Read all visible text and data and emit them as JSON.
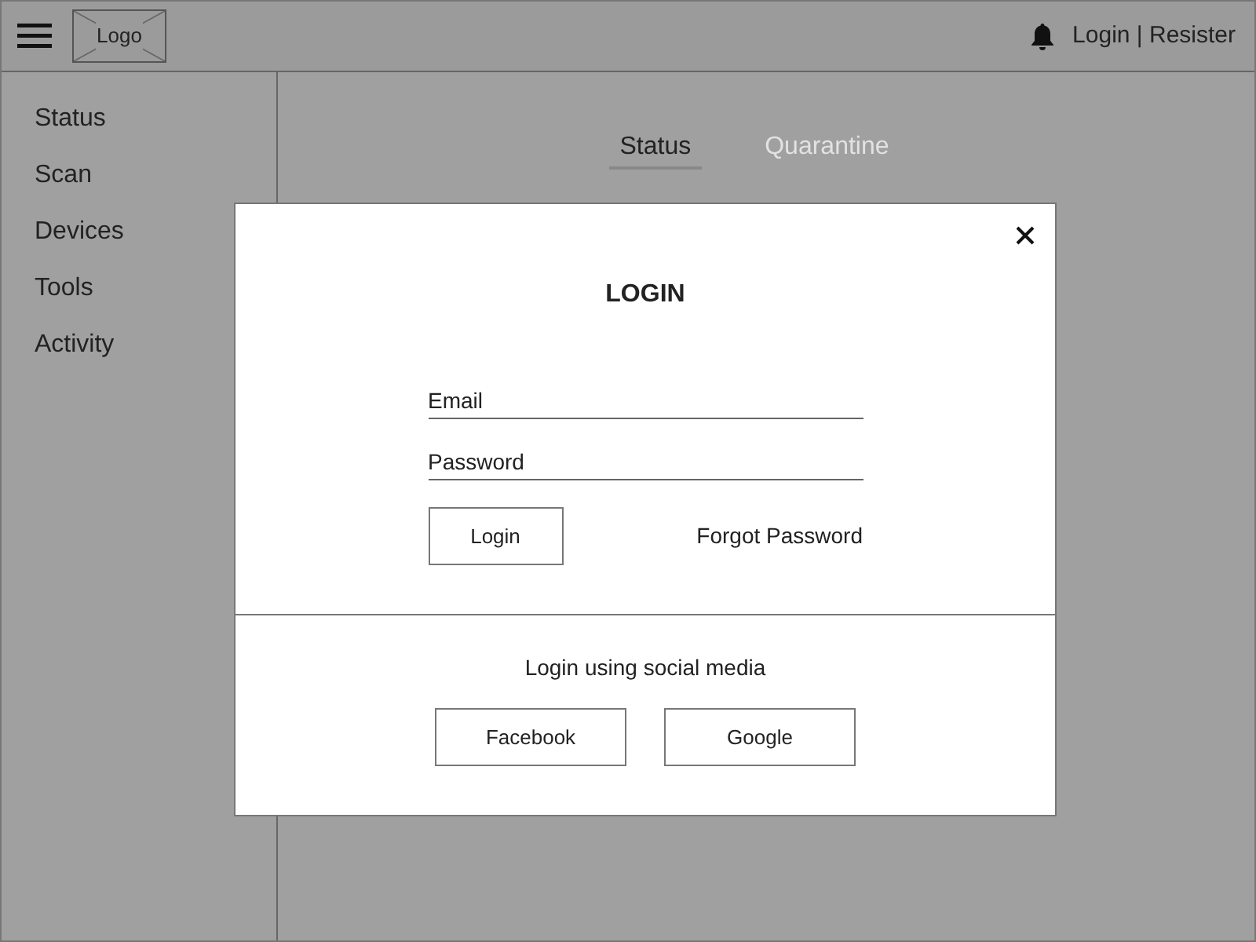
{
  "header": {
    "logo": "Logo",
    "auth_links": "Login | Resister"
  },
  "sidebar": {
    "items": [
      {
        "label": "Status"
      },
      {
        "label": "Scan"
      },
      {
        "label": "Devices"
      },
      {
        "label": "Tools"
      },
      {
        "label": "Activity"
      }
    ]
  },
  "tabs": [
    {
      "label": "Status",
      "selected": true
    },
    {
      "label": "Quarantine",
      "selected": false
    }
  ],
  "dialog": {
    "title": "LOGIN",
    "fields": [
      {
        "placeholder": "Email"
      },
      {
        "placeholder": "Password"
      }
    ],
    "login_button": "Login",
    "forgot_link": "Forgot Password",
    "social_caption": "Login using social media",
    "social_buttons": [
      "Facebook",
      "Google"
    ]
  }
}
